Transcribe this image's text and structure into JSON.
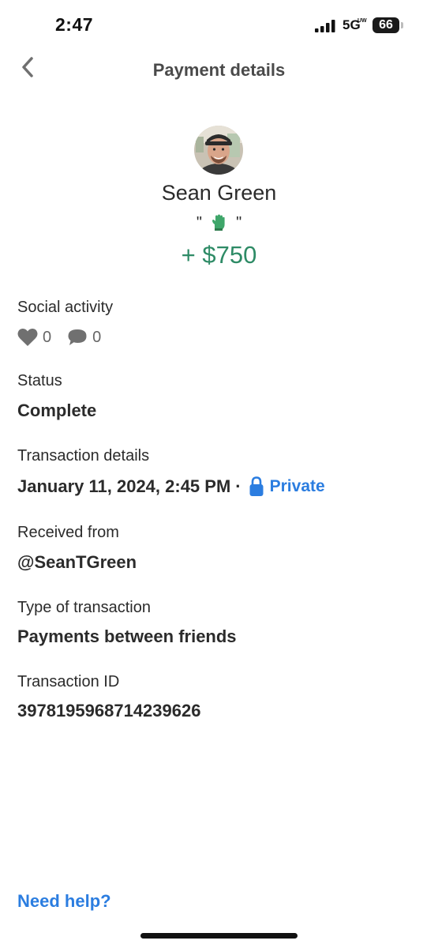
{
  "status_bar": {
    "time": "2:47",
    "network": "5G",
    "network_sup": "UW",
    "battery": "66"
  },
  "header": {
    "title": "Payment details"
  },
  "profile": {
    "name": "Sean Green",
    "note_open": "\"",
    "note_close": "\"",
    "note_icon": "gloves-icon",
    "amount": "+ $750"
  },
  "social": {
    "label": "Social activity",
    "likes": "0",
    "comments": "0"
  },
  "status": {
    "label": "Status",
    "value": "Complete"
  },
  "transaction_details": {
    "label": "Transaction details",
    "datetime": "January 11, 2024, 2:45 PM",
    "separator": "·",
    "privacy": "Private"
  },
  "received_from": {
    "label": "Received from",
    "value": "@SeanTGreen"
  },
  "transaction_type": {
    "label": "Type of transaction",
    "value": "Payments between friends"
  },
  "transaction_id": {
    "label": "Transaction ID",
    "value": "3978195968714239626"
  },
  "footer": {
    "help": "Need help?"
  },
  "colors": {
    "amount": "#2e8b66",
    "link": "#2b7de0",
    "text": "#2b2b2b",
    "icon_gray": "#707070"
  }
}
